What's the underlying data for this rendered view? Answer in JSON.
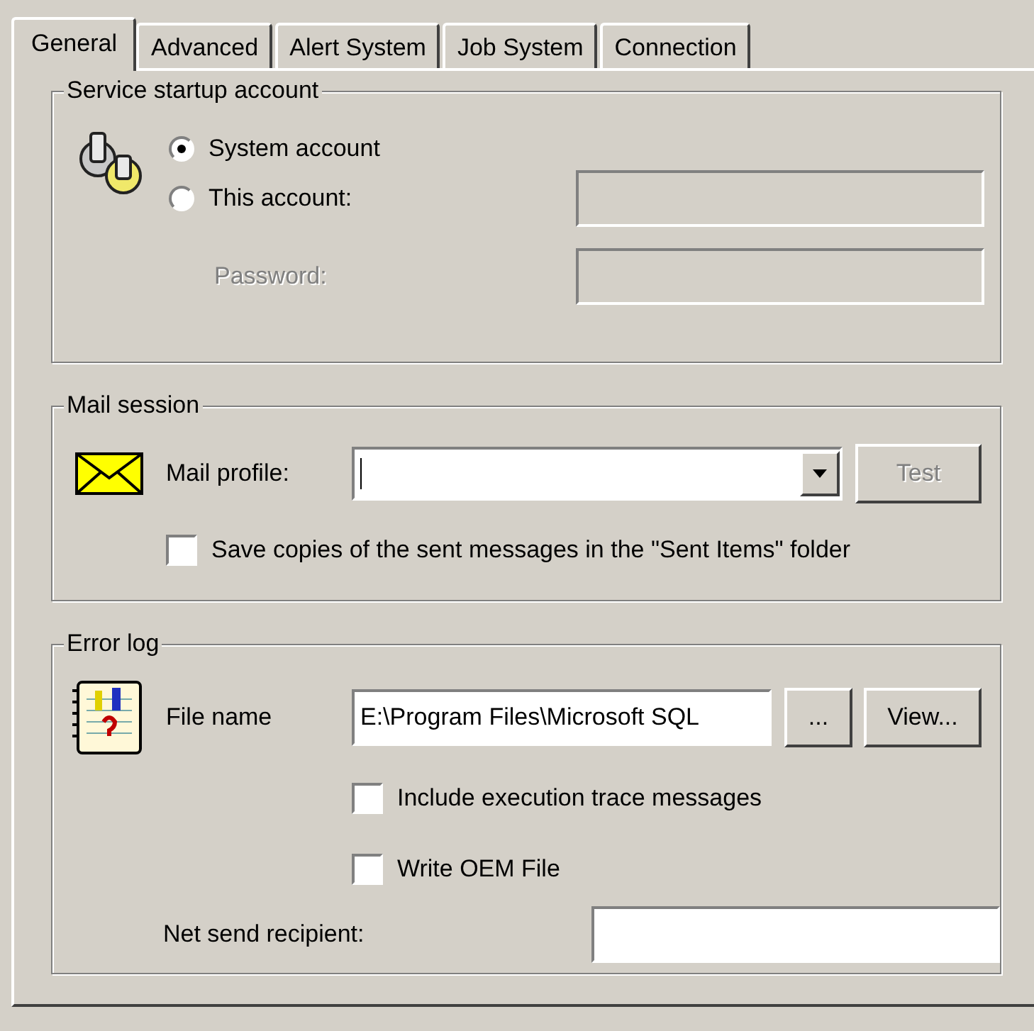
{
  "tabs": [
    {
      "label": "General",
      "selected": true
    },
    {
      "label": "Advanced",
      "selected": false
    },
    {
      "label": "Alert System",
      "selected": false
    },
    {
      "label": "Job System",
      "selected": false
    },
    {
      "label": "Connection",
      "selected": false
    }
  ],
  "service_account": {
    "title": "Service startup account",
    "options": [
      {
        "label": "System account",
        "selected": true
      },
      {
        "label": "This account:",
        "selected": false
      }
    ],
    "account_field": {
      "disabled": true
    },
    "password": {
      "label": "Password:",
      "disabled": true
    }
  },
  "mail_session": {
    "title": "Mail session",
    "profile_label": "Mail profile:",
    "test_button": {
      "label": "Test",
      "disabled": true
    },
    "save_copies": {
      "label": "Save copies of the sent messages in the \"Sent Items\" folder",
      "checked": false
    }
  },
  "error_log": {
    "title": "Error log",
    "file_label": "File name",
    "file_value": "E:\\Program Files\\Microsoft SQL",
    "browse_button": "...",
    "view_button": "View...",
    "options": [
      {
        "label": "Include execution trace messages",
        "checked": false
      },
      {
        "label": "Write OEM File",
        "checked": false
      }
    ],
    "net_send_label": "Net send recipient:"
  }
}
